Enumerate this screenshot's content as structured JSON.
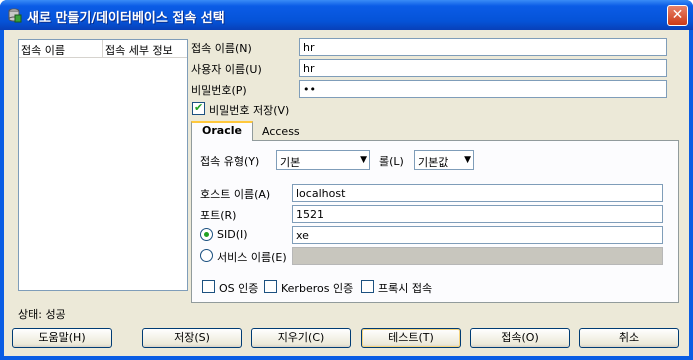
{
  "window": {
    "title": "새로 만들기/데이터베이스 접속 선택",
    "close_glyph": "✕"
  },
  "list": {
    "col_name": "접속 이름",
    "col_details": "접속 세부 정보"
  },
  "form": {
    "conn_name_label": "접속 이름(N)",
    "conn_name_value": "hr",
    "user_label": "사용자 이름(U)",
    "user_value": "hr",
    "password_label": "비밀번호(P)",
    "password_value": "••",
    "save_password_label": "비밀번호 저장(V)",
    "save_password_checked": true
  },
  "tabs": {
    "active": "Oracle",
    "inactive": "Access"
  },
  "oracle": {
    "conn_type_label": "접속 유형(Y)",
    "conn_type_value": "기본",
    "role_label": "롤(L)",
    "role_value": "기본값",
    "host_label": "호스트 이름(A)",
    "host_value": "localhost",
    "port_label": "포트(R)",
    "port_value": "1521",
    "sid_label": "SID(I)",
    "sid_value": "xe",
    "service_label": "서비스 이름(E)",
    "service_value": "",
    "os_auth_label": "OS 인증",
    "kerberos_label": "Kerberos 인증",
    "proxy_label": "프록시 접속"
  },
  "status": "상태: 성공",
  "buttons": {
    "help": "도움말(H)",
    "save": "저장(S)",
    "clear": "지우기(C)",
    "test": "테스트(T)",
    "connect": "접속(O)",
    "cancel": "취소"
  }
}
